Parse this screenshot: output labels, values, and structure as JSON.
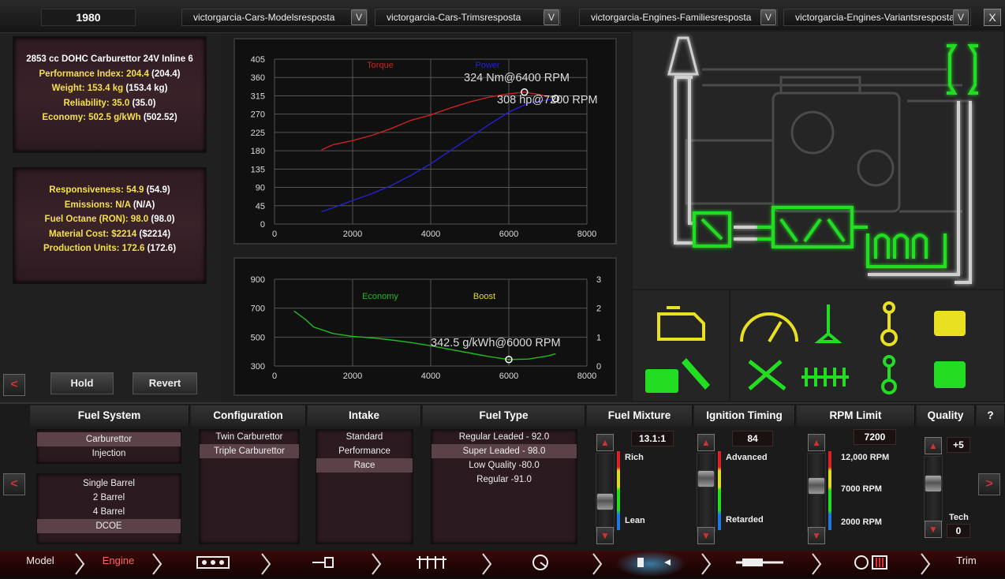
{
  "topbar": {
    "year": "1980",
    "dropdowns": [
      "victorgarcia-Cars-Modelsresposta",
      "victorgarcia-Cars-Trimsresposta",
      "victorgarcia-Engines-Familiesresposta",
      "victorgarcia-Engines-Variantsresposta"
    ],
    "dropdown_arrow": "V",
    "close_label": "X"
  },
  "stats_top": {
    "title": "2853 cc DOHC Carburettor 24V Inline 6",
    "rows": [
      {
        "label": "Performance Index: 204.4",
        "paren": "(204.4)"
      },
      {
        "label": "Weight: 153.4 kg",
        "paren": "(153.4 kg)"
      },
      {
        "label": "Reliability: 35.0",
        "paren": "(35.0)"
      },
      {
        "label": "Economy: 502.5 g/kWh",
        "paren": "(502.52)"
      }
    ]
  },
  "stats_bottom": {
    "rows": [
      {
        "label": "Responsiveness: 54.9",
        "paren": "(54.9)"
      },
      {
        "label": "Emissions: N/A",
        "paren": "(N/A)"
      },
      {
        "label": "Fuel Octane (RON): 98.0",
        "paren": "(98.0)"
      },
      {
        "label": "Material Cost: $2214",
        "paren": "($2214)"
      },
      {
        "label": "Production Units: 172.6",
        "paren": "(172.6)"
      }
    ]
  },
  "buttons": {
    "back": "<",
    "hold": "Hold",
    "revert": "Revert",
    "prev": "<",
    "next": ">",
    "help": "?"
  },
  "chart_data": [
    {
      "type": "line",
      "series": [
        {
          "name": "Torque",
          "color": "#cc2222",
          "x": [
            1200,
            1500,
            2000,
            2500,
            3000,
            3500,
            4000,
            4500,
            5000,
            5500,
            6000,
            6400,
            6800,
            7000
          ],
          "values": [
            182,
            195,
            205,
            218,
            235,
            255,
            268,
            285,
            300,
            312,
            320,
            324,
            318,
            312
          ]
        },
        {
          "name": "Power",
          "color": "#2222cc",
          "x": [
            1200,
            1500,
            2000,
            2500,
            3000,
            3500,
            4000,
            4500,
            5000,
            5500,
            6000,
            6500,
            7000,
            7200
          ],
          "values": [
            30,
            40,
            58,
            75,
            95,
            120,
            148,
            180,
            212,
            245,
            275,
            297,
            305,
            308
          ]
        }
      ],
      "annotations": [
        "324 Nm@6400 RPM",
        "308 hp@7200 RPM"
      ],
      "x_ticks": [
        "0",
        "2000",
        "4000",
        "6000",
        "8000"
      ],
      "y_ticks": [
        "0",
        "45",
        "90",
        "135",
        "180",
        "225",
        "270",
        "315",
        "360",
        "405"
      ],
      "xlim": [
        0,
        8000
      ],
      "ylim": [
        0,
        405
      ]
    },
    {
      "type": "line",
      "series": [
        {
          "name": "Economy",
          "color": "#22bb22",
          "x": [
            500,
            800,
            1000,
            1500,
            2000,
            2500,
            3000,
            3500,
            4000,
            4500,
            5000,
            5500,
            6000,
            6500,
            7000,
            7200
          ],
          "values": [
            680,
            620,
            570,
            525,
            505,
            495,
            480,
            462,
            440,
            415,
            390,
            365,
            345,
            348,
            370,
            385
          ]
        },
        {
          "name": "Boost",
          "color": "#dddd22",
          "x": [],
          "values": []
        }
      ],
      "annotations": [
        "342.5 g/kWh@6000 RPM"
      ],
      "x_ticks": [
        "0",
        "2000",
        "4000",
        "6000",
        "8000"
      ],
      "y_ticks": [
        "300",
        "500",
        "700",
        "900"
      ],
      "y2_ticks": [
        "0",
        "1",
        "2",
        "3"
      ],
      "xlim": [
        0,
        8000
      ],
      "ylim": [
        300,
        900
      ],
      "y2lim": [
        0,
        3
      ]
    }
  ],
  "columns": {
    "fuel_system": {
      "header": "Fuel System",
      "types": [
        "Carburettor",
        "Injection"
      ],
      "type_selected": 0,
      "barrels": [
        "Single Barrel",
        "2 Barrel",
        "4 Barrel",
        "DCOE"
      ],
      "barrel_selected": 3
    },
    "configuration": {
      "header": "Configuration",
      "items": [
        "Twin Carburettor",
        "Triple Carburettor"
      ],
      "selected": 1
    },
    "intake": {
      "header": "Intake",
      "items": [
        "Standard",
        "Performance",
        "Race"
      ],
      "selected": 2
    },
    "fuel_type": {
      "header": "Fuel Type",
      "items": [
        "Regular Leaded - 92.0",
        "Super Leaded - 98.0",
        "Low Quality -80.0",
        "Regular -91.0"
      ],
      "selected": 1
    },
    "fuel_mixture": {
      "header": "Fuel Mixture",
      "value": "13.1:1",
      "top_label": "Rich",
      "bottom_label": "Lean",
      "level": 0.35
    },
    "ignition_timing": {
      "header": "Ignition Timing",
      "value": "84",
      "top_label": "Advanced",
      "bottom_label": "Retarded",
      "level": 0.72
    },
    "rpm_limit": {
      "header": "RPM Limit",
      "value": "7200",
      "labels": [
        "12,000 RPM",
        "7000 RPM",
        "2000 RPM"
      ],
      "level": 0.6
    },
    "quality": {
      "header": "Quality",
      "value": "+5",
      "tech_label": "Tech",
      "tech_value": "0",
      "level": 0.62
    }
  },
  "nav": {
    "items": [
      "Model",
      "Engine",
      "Trim"
    ],
    "active": "Engine"
  },
  "colors": {
    "accent_red": "#cc2222",
    "active_icon_green": "#22dd22",
    "inactive_icon_yellow": "#e8e020",
    "stat_yellow": "#f4e04a"
  }
}
